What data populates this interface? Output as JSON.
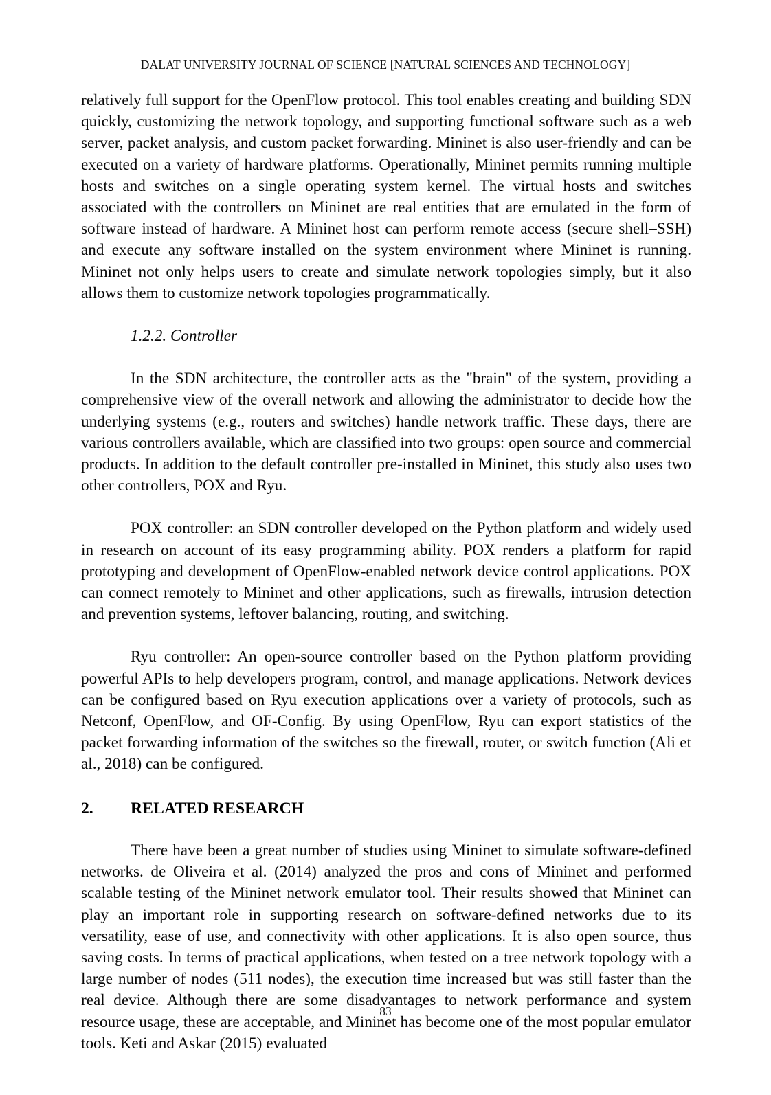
{
  "page": {
    "running_head": "DALAT UNIVERSITY JOURNAL OF SCIENCE [NATURAL SCIENCES AND TECHNOLOGY]",
    "folio": "83",
    "text_color": "#0a0a0a",
    "background": "#ffffff"
  },
  "content": {
    "para_mininet_continued": "relatively full support for the OpenFlow protocol. This tool enables creating and building SDN quickly, customizing the network topology, and supporting functional software such as a web server, packet analysis, and custom packet forwarding. Mininet is also user-friendly and can be executed on a variety of hardware platforms. Operationally, Mininet permits running multiple hosts and switches on a single operating system kernel. The virtual hosts and switches associated with the controllers on Mininet are real entities that are emulated in the form of software instead of hardware. A Mininet host can perform remote access (secure shell–SSH) and execute any software installed on the system environment where Mininet is running. Mininet not only helps users to create and simulate network topologies simply, but it also allows them to customize network topologies programmatically.",
    "subheading_controller": "1.2.2. Controller",
    "para_controller": "In the SDN architecture, the controller acts as the \"brain\" of the system, providing a comprehensive view of the overall network and allowing the administrator to decide how the underlying systems (e.g., routers and switches) handle network traffic. These days, there are various controllers available, which are classified into two groups: open source and commercial products. In addition to the default controller pre-installed in Mininet, this study also uses two other controllers, POX and Ryu.",
    "para_pox": "POX controller: an SDN controller developed on the Python platform and widely used in research on account of its easy programming ability. POX renders a platform for rapid prototyping and development of OpenFlow-enabled network device control applications. POX can connect remotely to Mininet and other applications, such as firewalls, intrusion detection and prevention systems, leftover balancing, routing, and switching.",
    "para_ryu": "Ryu controller: An open-source controller based on the Python platform providing powerful APIs to help developers program, control, and manage applications. Network devices can be configured based on Ryu execution applications over a variety of protocols, such as Netconf, OpenFlow, and OF-Config. By using OpenFlow, Ryu can export statistics of the packet forwarding information of the switches so the firewall, router, or switch function (Ali et al., 2018) can be configured.",
    "section_2_number": "2.",
    "section_2_title": "RELATED RESEARCH",
    "para_related_research": "There have been a great number of studies using Mininet to simulate software-defined networks. de Oliveira et al. (2014) analyzed the pros and cons of Mininet and performed scalable testing of the Mininet network emulator tool. Their results showed that Mininet can play an important role in supporting research on software-defined networks due to its versatility, ease of use, and connectivity with other applications. It is also open source, thus saving costs. In terms of practical applications, when tested on a tree network topology with a large number of nodes (511 nodes), the execution time increased but was still faster than the real device. Although there are some disadvantages to network performance and system resource usage, these are acceptable, and Mininet has become one of the most popular emulator tools. Keti and Askar (2015) evaluated"
  }
}
